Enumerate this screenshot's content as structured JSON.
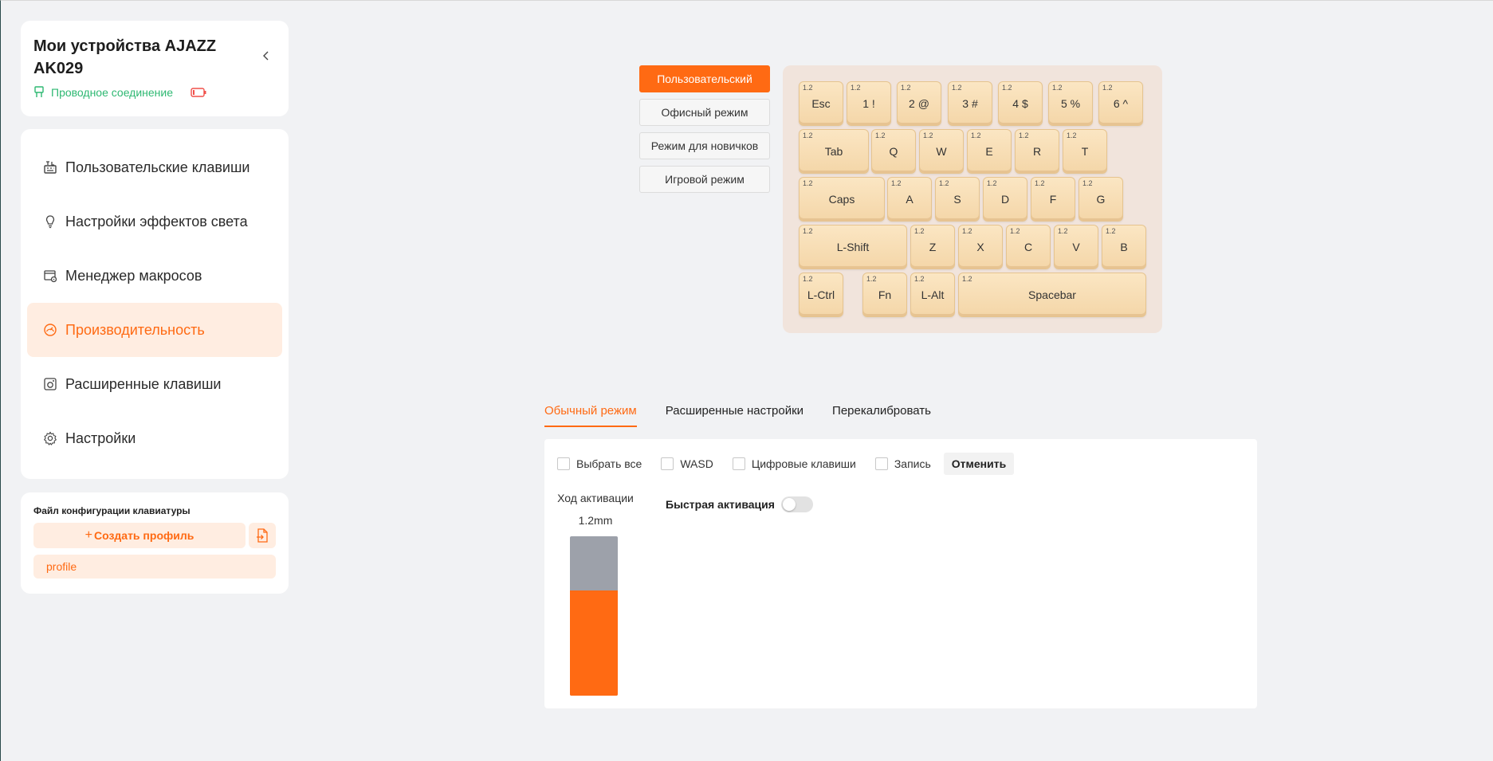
{
  "device": {
    "title": "Мои устройства AJAZZ AK029",
    "connection": "Проводное соединение"
  },
  "nav": {
    "items": [
      {
        "label": "Пользовательские клавиши",
        "icon": "keyboard-customize-icon",
        "active": false
      },
      {
        "label": "Настройки эффектов света",
        "icon": "lightbulb-icon",
        "active": false
      },
      {
        "label": "Менеджер макросов",
        "icon": "macro-icon",
        "active": false
      },
      {
        "label": "Производительность",
        "icon": "gauge-icon",
        "active": true
      },
      {
        "label": "Расширенные клавиши",
        "icon": "advanced-key-icon",
        "active": false
      },
      {
        "label": "Настройки",
        "icon": "gear-icon",
        "active": false
      }
    ]
  },
  "profiles": {
    "heading": "Файл конфигурации клавиатуры",
    "create_label": "Создать профиль",
    "items": [
      "profile"
    ]
  },
  "modes": [
    {
      "label": "Пользовательский",
      "active": true
    },
    {
      "label": "Офисный режим",
      "active": false
    },
    {
      "label": "Режим для новичков",
      "active": false
    },
    {
      "label": "Игровой режим",
      "active": false
    }
  ],
  "keyboard": {
    "keys": [
      {
        "label": "Esc",
        "value": "1.2"
      },
      {
        "label": "1 !",
        "value": "1.2"
      },
      {
        "label": "2 @",
        "value": "1.2"
      },
      {
        "label": "3 #",
        "value": "1.2"
      },
      {
        "label": "4 $",
        "value": "1.2"
      },
      {
        "label": "5 %",
        "value": "1.2"
      },
      {
        "label": "6 ^",
        "value": "1.2"
      },
      {
        "label": "Tab",
        "value": "1.2"
      },
      {
        "label": "Q",
        "value": "1.2"
      },
      {
        "label": "W",
        "value": "1.2"
      },
      {
        "label": "E",
        "value": "1.2"
      },
      {
        "label": "R",
        "value": "1.2"
      },
      {
        "label": "T",
        "value": "1.2"
      },
      {
        "label": "Caps",
        "value": "1.2"
      },
      {
        "label": "A",
        "value": "1.2"
      },
      {
        "label": "S",
        "value": "1.2"
      },
      {
        "label": "D",
        "value": "1.2"
      },
      {
        "label": "F",
        "value": "1.2"
      },
      {
        "label": "G",
        "value": "1.2"
      },
      {
        "label": "L-Shift",
        "value": "1.2"
      },
      {
        "label": "Z",
        "value": "1.2"
      },
      {
        "label": "X",
        "value": "1.2"
      },
      {
        "label": "C",
        "value": "1.2"
      },
      {
        "label": "V",
        "value": "1.2"
      },
      {
        "label": "B",
        "value": "1.2"
      },
      {
        "label": "L-Ctrl",
        "value": "1.2"
      },
      {
        "label": "Fn",
        "value": "1.2"
      },
      {
        "label": "L-Alt",
        "value": "1.2"
      },
      {
        "label": "Spacebar",
        "value": "1.2"
      }
    ]
  },
  "tabs": [
    {
      "label": "Обычный режим",
      "active": true
    },
    {
      "label": "Расширенные настройки",
      "active": false
    },
    {
      "label": "Перекалибровать",
      "active": false
    }
  ],
  "panel": {
    "filters": [
      "Выбрать все",
      "WASD",
      "Цифровые клавиши",
      "Запись"
    ],
    "cancel_label": "Отменить",
    "travel_label": "Ход активации",
    "travel_value": "1.2mm",
    "travel_fill_fraction": 0.66,
    "quick_activation_label": "Быстрая активация",
    "quick_activation_on": false
  },
  "colors": {
    "accent": "#ff6a13",
    "accent_light": "#ffede1",
    "success": "#2eb872",
    "key_bg": "#f4d6a8",
    "keyboard_bg": "#f1e4dc",
    "bar_gray": "#9da1aa"
  }
}
